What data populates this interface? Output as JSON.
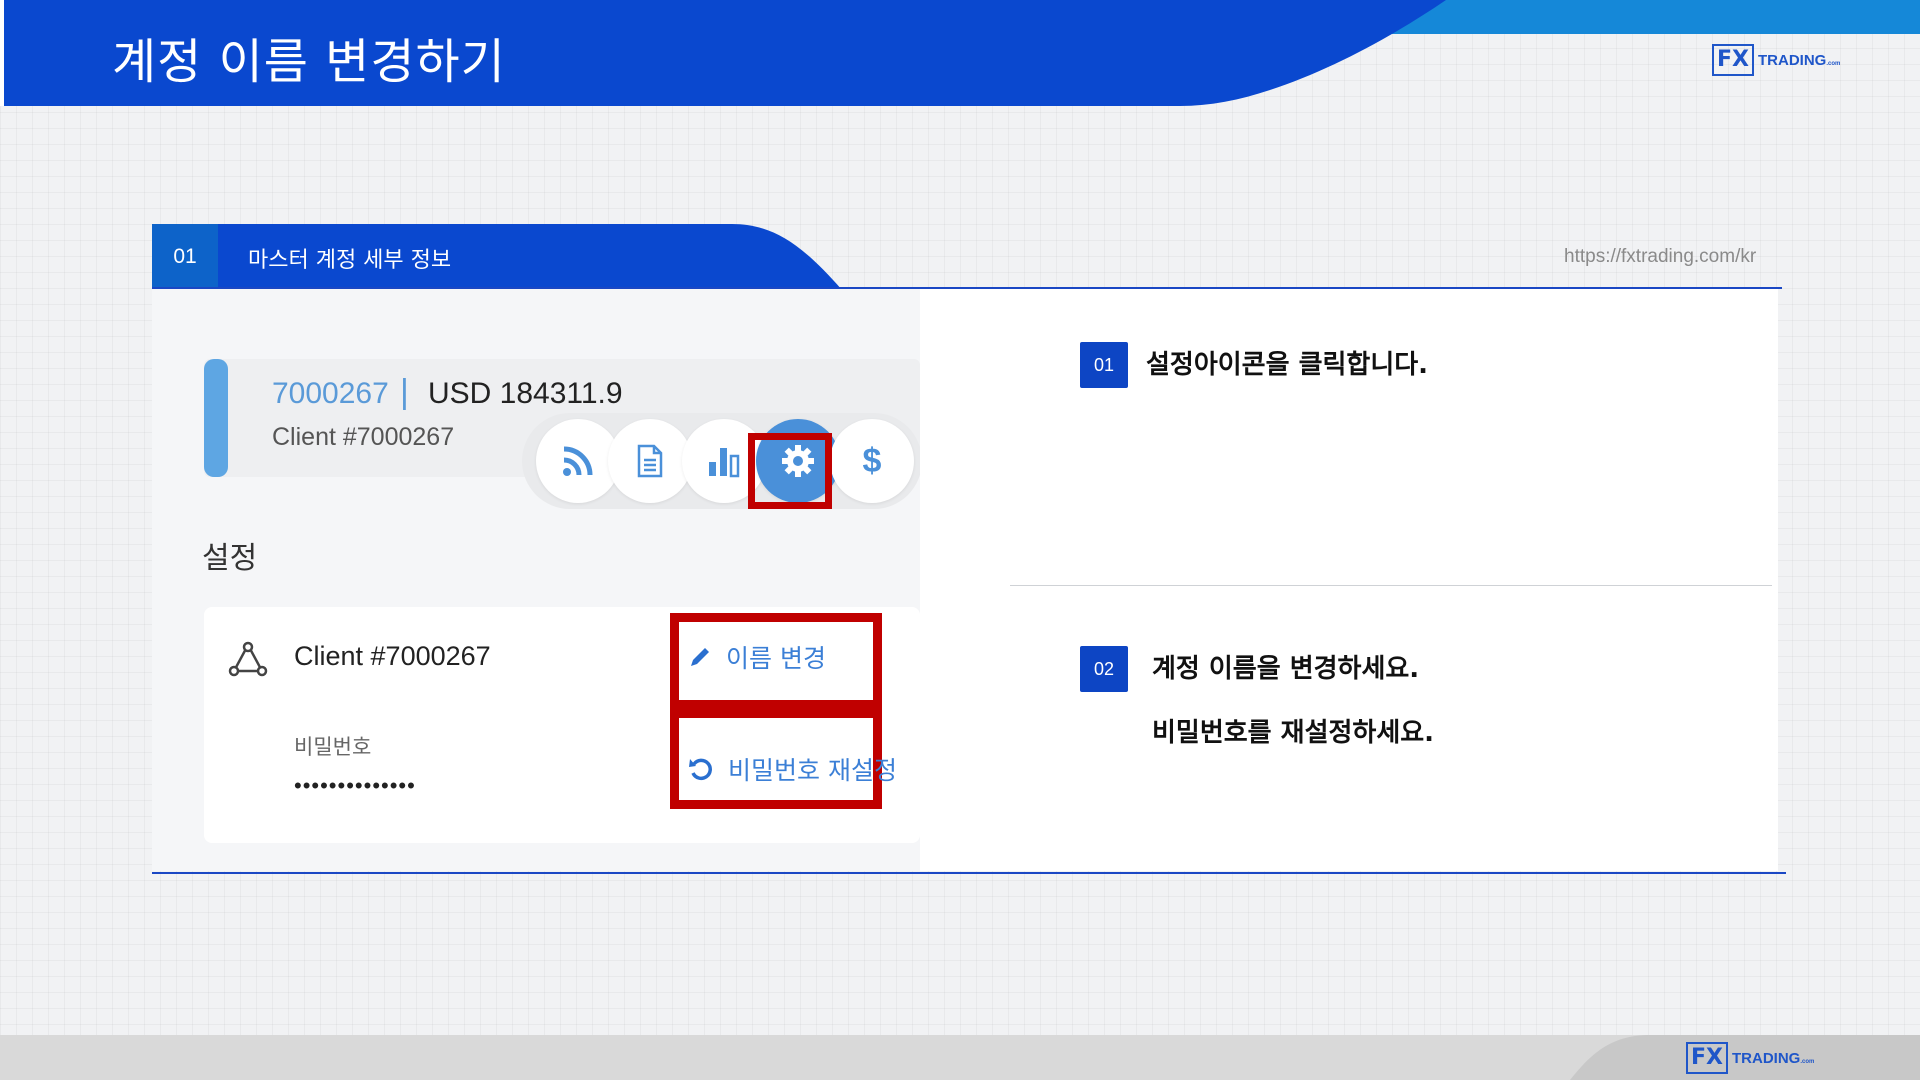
{
  "header": {
    "title": "계정 이름 변경하기"
  },
  "logo": {
    "mark": "FX",
    "text": "TRADING",
    "suffix": ".com"
  },
  "section": {
    "number": "01",
    "title": "마스터 계정 세부 정보",
    "url": "https://fxtrading.com/kr"
  },
  "account": {
    "id": "7000267",
    "separator": "|",
    "balance": "USD 184311.9",
    "client": "Client #7000267"
  },
  "icons": [
    "rss-icon",
    "document-icon",
    "bar-chart-icon",
    "gear-icon",
    "dollar-icon"
  ],
  "settings": {
    "label": "설정",
    "client": "Client #7000267",
    "password_label": "비밀번호",
    "password_value": "••••••••••••••",
    "rename_label": "이름 변경",
    "reset_label": "비밀번호 재설정"
  },
  "steps": [
    {
      "number": "01",
      "lines": [
        "설정아이콘을 클릭합니다."
      ]
    },
    {
      "number": "02",
      "lines": [
        "계정 이름을 변경하세요.",
        "비밀번호를 재설정하세요."
      ]
    }
  ],
  "colors": {
    "brand_blue": "#0d45c4",
    "header_blue": "#0a48cf",
    "highlight_red": "#c00000",
    "link_blue": "#3b7fd6"
  }
}
